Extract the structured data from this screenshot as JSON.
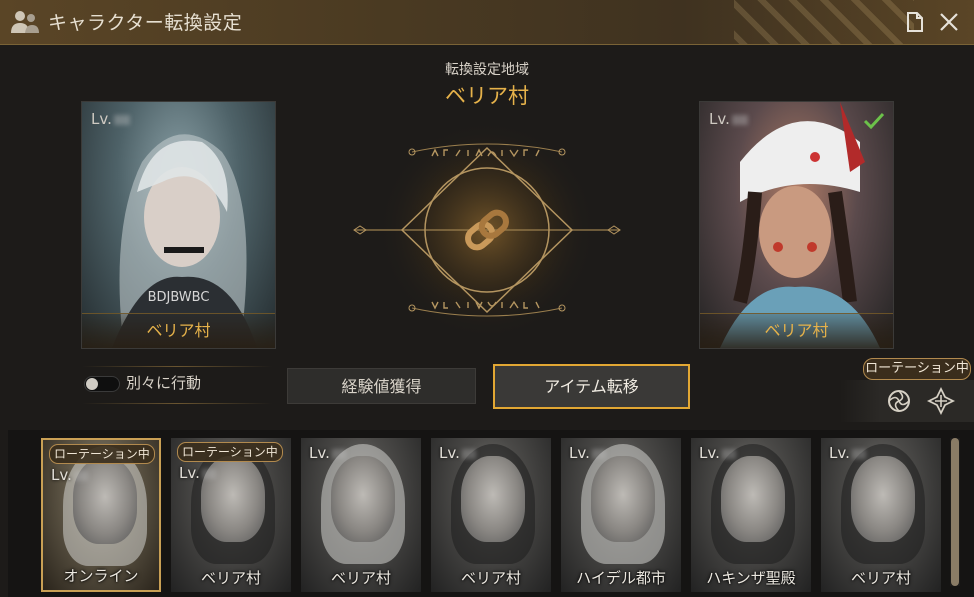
{
  "window": {
    "title": "キャラクター転換設定",
    "icons": {
      "title": "people-icon",
      "doc": "document-icon",
      "close": "close-icon"
    }
  },
  "region": {
    "label": "転換設定地域",
    "name": "ベリア村"
  },
  "left_character": {
    "level_label": "Lv.",
    "name": "BDJBWBC",
    "location": "ベリア村"
  },
  "right_character": {
    "level_label": "Lv.",
    "location": "ベリア村",
    "selected": true
  },
  "controls": {
    "separate_action_label": "別々に行動",
    "separate_action_on": false,
    "exp_button": "経験値獲得",
    "item_button": "アイテム転移"
  },
  "rotation": {
    "badge": "ローテーション中",
    "icons": [
      "rose-emblem-icon",
      "cross-emblem-icon"
    ]
  },
  "characters": [
    {
      "level_label": "Lv.",
      "location": "オンライン",
      "badge": "ローテーション中",
      "selected": true
    },
    {
      "level_label": "Lv.",
      "location": "ベリア村",
      "badge": "ローテーション中",
      "selected": false
    },
    {
      "level_label": "Lv.",
      "location": "ベリア村",
      "badge": "",
      "selected": false
    },
    {
      "level_label": "Lv.",
      "location": "ベリア村",
      "badge": "",
      "selected": false
    },
    {
      "level_label": "Lv.",
      "location": "ハイデル都市",
      "badge": "",
      "selected": false
    },
    {
      "level_label": "Lv.",
      "location": "ハキンザ聖殿",
      "badge": "",
      "selected": false
    },
    {
      "level_label": "Lv.",
      "location": "ベリア村",
      "badge": "",
      "selected": false
    }
  ],
  "colors": {
    "accent_gold": "#e6b24a",
    "selected_border": "#e2a733",
    "check_green": "#6cc14a"
  }
}
